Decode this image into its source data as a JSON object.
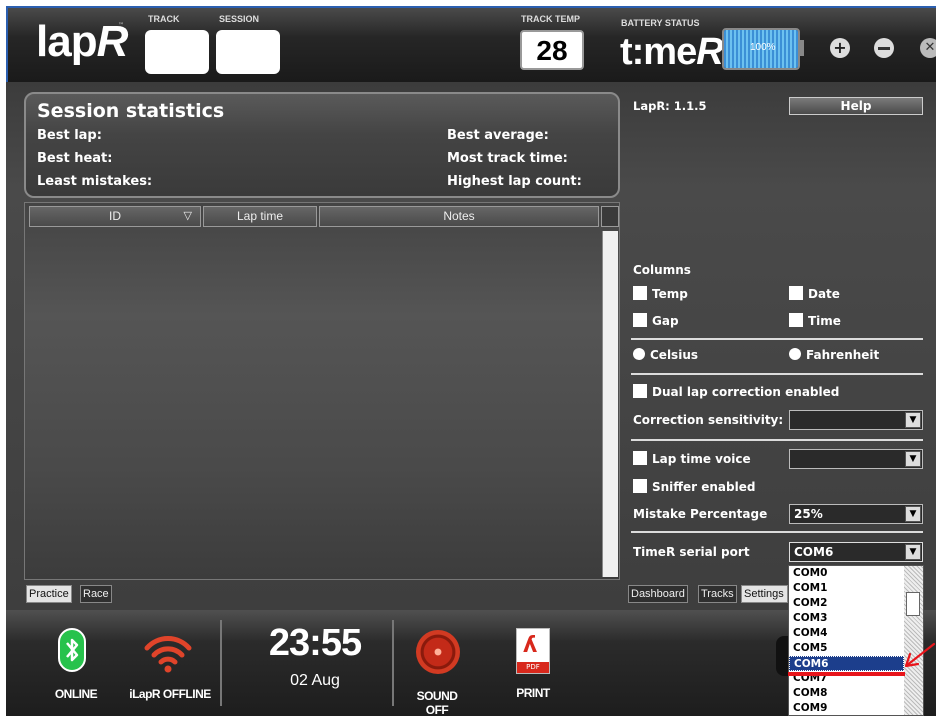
{
  "header": {
    "logo": "lapR",
    "logo_tm": "™",
    "track_label": "TRACK",
    "session_label": "SESSION",
    "track_temp_label": "TRACK TEMP",
    "track_temp_value": "28",
    "battery_label": "BATTERY STATUS",
    "battery_value": "100%",
    "battery_level": 1.0,
    "timer_logo": "t:meR",
    "icons": [
      "plus-icon",
      "minus-icon",
      "close-icon"
    ]
  },
  "stats": {
    "title": "Session statistics",
    "best_lap": "Best lap:",
    "best_heat": "Best heat:",
    "least_mistakes": "Least mistakes:",
    "best_average": "Best average:",
    "most_track_time": "Most track time:",
    "highest_lap_count": "Highest lap count:"
  },
  "table": {
    "columns": [
      "ID",
      "Lap time",
      "Notes"
    ],
    "sort_indicator": "▽",
    "rows": []
  },
  "left_tabs": [
    "Practice",
    "Race"
  ],
  "settings": {
    "version": "LapR: 1.1.5",
    "help": "Help",
    "columns_label": "Columns",
    "temp": "Temp",
    "date": "Date",
    "gap": "Gap",
    "time": "Time",
    "celsius": "Celsius",
    "fahrenheit": "Fahrenheit",
    "dual_lap": "Dual lap correction enabled",
    "correction_sensitivity": "Correction sensitivity:",
    "lap_time_voice": "Lap time voice",
    "sniffer": "Sniffer enabled",
    "mistake_percentage": "Mistake Percentage",
    "mistake_value": "25%",
    "serial_port": "TimeR serial port",
    "serial_value": "COM6",
    "ports": [
      "COM0",
      "COM1",
      "COM2",
      "COM3",
      "COM4",
      "COM5",
      "COM6",
      "COM7",
      "COM8",
      "COM9"
    ],
    "selected_port": "COM6"
  },
  "right_tabs": [
    "Dashboard",
    "Tracks",
    "Settings"
  ],
  "bottom": {
    "online": "ONLINE",
    "ilapr": "iLapR OFFLINE",
    "clock": "23:55",
    "date": "02 Aug",
    "sound": "SOUND OFF",
    "print": "PRINT",
    "pdf_label": "PDF"
  },
  "colors": {
    "bluetooth": "#27c24c",
    "wifi": "#e0442a",
    "highlight": "#1c3e8c",
    "annotation": "#e8151b"
  }
}
